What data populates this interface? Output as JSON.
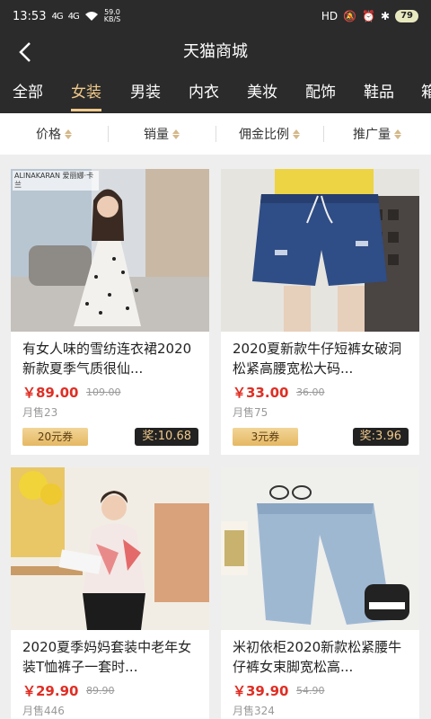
{
  "status": {
    "time": "13:53",
    "speed_value": "59.0",
    "speed_unit": "KB/S",
    "signal1": "4G",
    "signal2": "4G",
    "hd": "HD",
    "battery": "79"
  },
  "header": {
    "title": "天猫商城"
  },
  "tabs": [
    {
      "label": "全部"
    },
    {
      "label": "女装"
    },
    {
      "label": "男装"
    },
    {
      "label": "内衣"
    },
    {
      "label": "美妆"
    },
    {
      "label": "配饰"
    },
    {
      "label": "鞋品"
    },
    {
      "label": "箱"
    }
  ],
  "active_tab": "女装",
  "sort": [
    {
      "label": "价格"
    },
    {
      "label": "销量"
    },
    {
      "label": "佣金比例"
    },
    {
      "label": "推广量"
    }
  ],
  "products": [
    {
      "brand": "ALINAKARAN 爱丽娜·卡兰",
      "title": "有女人味的雪纺连衣裙2020新款夏季气质很仙...",
      "price": "￥89.00",
      "old_price": "109.00",
      "sold": "月售23",
      "coupon": "20元券",
      "reward": "奖:10.68"
    },
    {
      "brand": "",
      "title": "2020夏新款牛仔短裤女破洞松紧高腰宽松大码...",
      "price": "￥33.00",
      "old_price": "36.00",
      "sold": "月售75",
      "coupon": "3元券",
      "reward": "奖:3.96"
    },
    {
      "brand": "",
      "title": "2020夏季妈妈套装中老年女装T恤裤子一套时...",
      "price": "￥29.90",
      "old_price": "89.90",
      "sold": "月售446",
      "coupon": "",
      "reward": ""
    },
    {
      "brand": "",
      "title": "米初依柜2020新款松紧腰牛仔裤女束脚宽松高...",
      "price": "￥39.90",
      "old_price": "54.90",
      "sold": "月售324",
      "coupon": "",
      "reward": ""
    }
  ],
  "colors": {
    "accent": "#f0c98a",
    "price": "#e02e24",
    "dark_bar": "#2b2b2b"
  }
}
